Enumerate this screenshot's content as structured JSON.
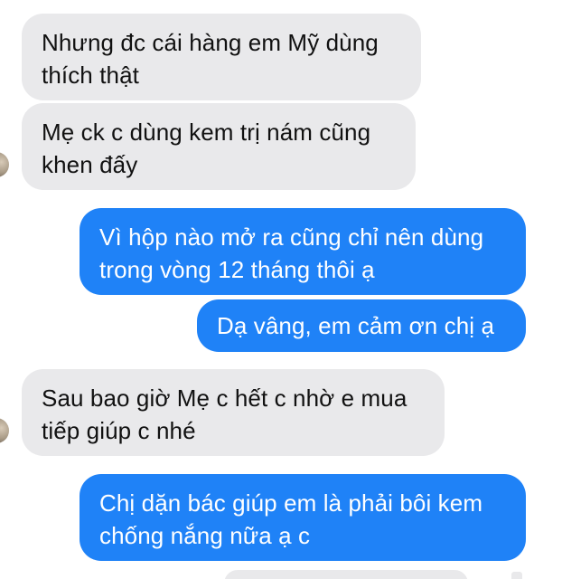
{
  "conversation": {
    "messages": [
      {
        "direction": "incoming",
        "text": "Nhưng đc cái hàng em Mỹ dùng\nthích thật"
      },
      {
        "direction": "incoming",
        "text": "Mẹ ck c dùng kem trị nám cũng\nkhen đấy"
      },
      {
        "direction": "outgoing",
        "text": "Vì hộp nào mở ra cũng chỉ nên dùng\ntrong vòng 12 tháng thôi ạ"
      },
      {
        "direction": "outgoing",
        "text": "Dạ vâng, em cảm ơn chị ạ"
      },
      {
        "direction": "incoming",
        "text": "Sau bao giờ Mẹ c hết c nhờ e mua\ntiếp giúp c nhé"
      },
      {
        "direction": "outgoing",
        "text": "Chị dặn bác giúp em là phải bôi kem\nchống nắng nữa ạ c"
      }
    ]
  },
  "colors": {
    "incoming_bubble": "#e9e9eb",
    "outgoing_bubble": "#1f82f7",
    "incoming_text": "#111111",
    "outgoing_text": "#ffffff",
    "background": "#ffffff"
  }
}
